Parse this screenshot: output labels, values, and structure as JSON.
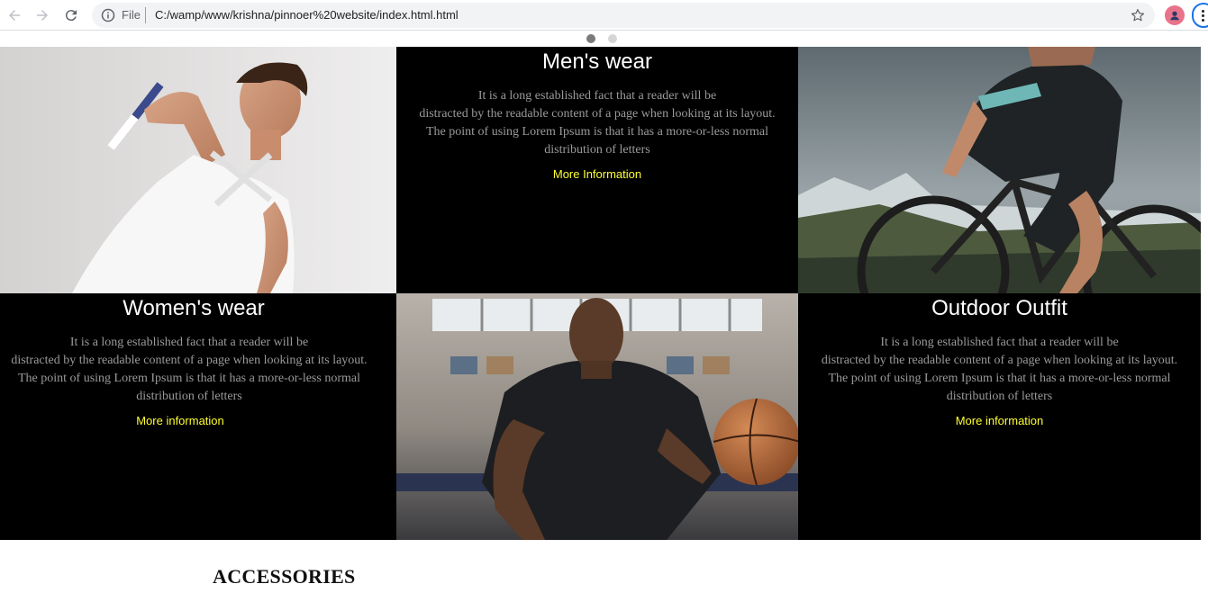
{
  "browser": {
    "scheme_label": "File",
    "url": "C:/wamp/www/krishna/pinnoer%20website/index.html.html"
  },
  "carousel": {
    "slides": 2,
    "active_index": 0,
    "colors": {
      "active": "#7a7a7a",
      "inactive": "#d6d6d6"
    }
  },
  "tiles": {
    "mens": {
      "title": "Men's wear",
      "desc_1": "It is a long established fact that a reader will be",
      "desc_2": "distracted by the readable content of a page when looking at its layout.",
      "desc_3": "The point of using Lorem Ipsum is that it has a more-or-less normal distribution of letters",
      "link": "More Information"
    },
    "womens": {
      "title": "Women's wear",
      "desc_1": "It is a long established fact that a reader will be",
      "desc_2": "distracted by the readable content of a page when looking at its layout.",
      "desc_3": "The point of using Lorem Ipsum is that it has a more-or-less normal distribution of letters",
      "link": "More information"
    },
    "outdoor": {
      "title": "Outdoor Outfit",
      "desc_1": "It is a long established fact that a reader will be",
      "desc_2": "distracted by the readable content of a page when looking at its layout.",
      "desc_3": "The point of using Lorem Ipsum is that it has a more-or-less normal distribution of letters",
      "link": "More information"
    }
  },
  "section": {
    "heading": "ACCESSORIES"
  },
  "colors": {
    "link": "#ffff33",
    "tile_bg": "#000000",
    "desc_text": "#9a9a9a"
  }
}
